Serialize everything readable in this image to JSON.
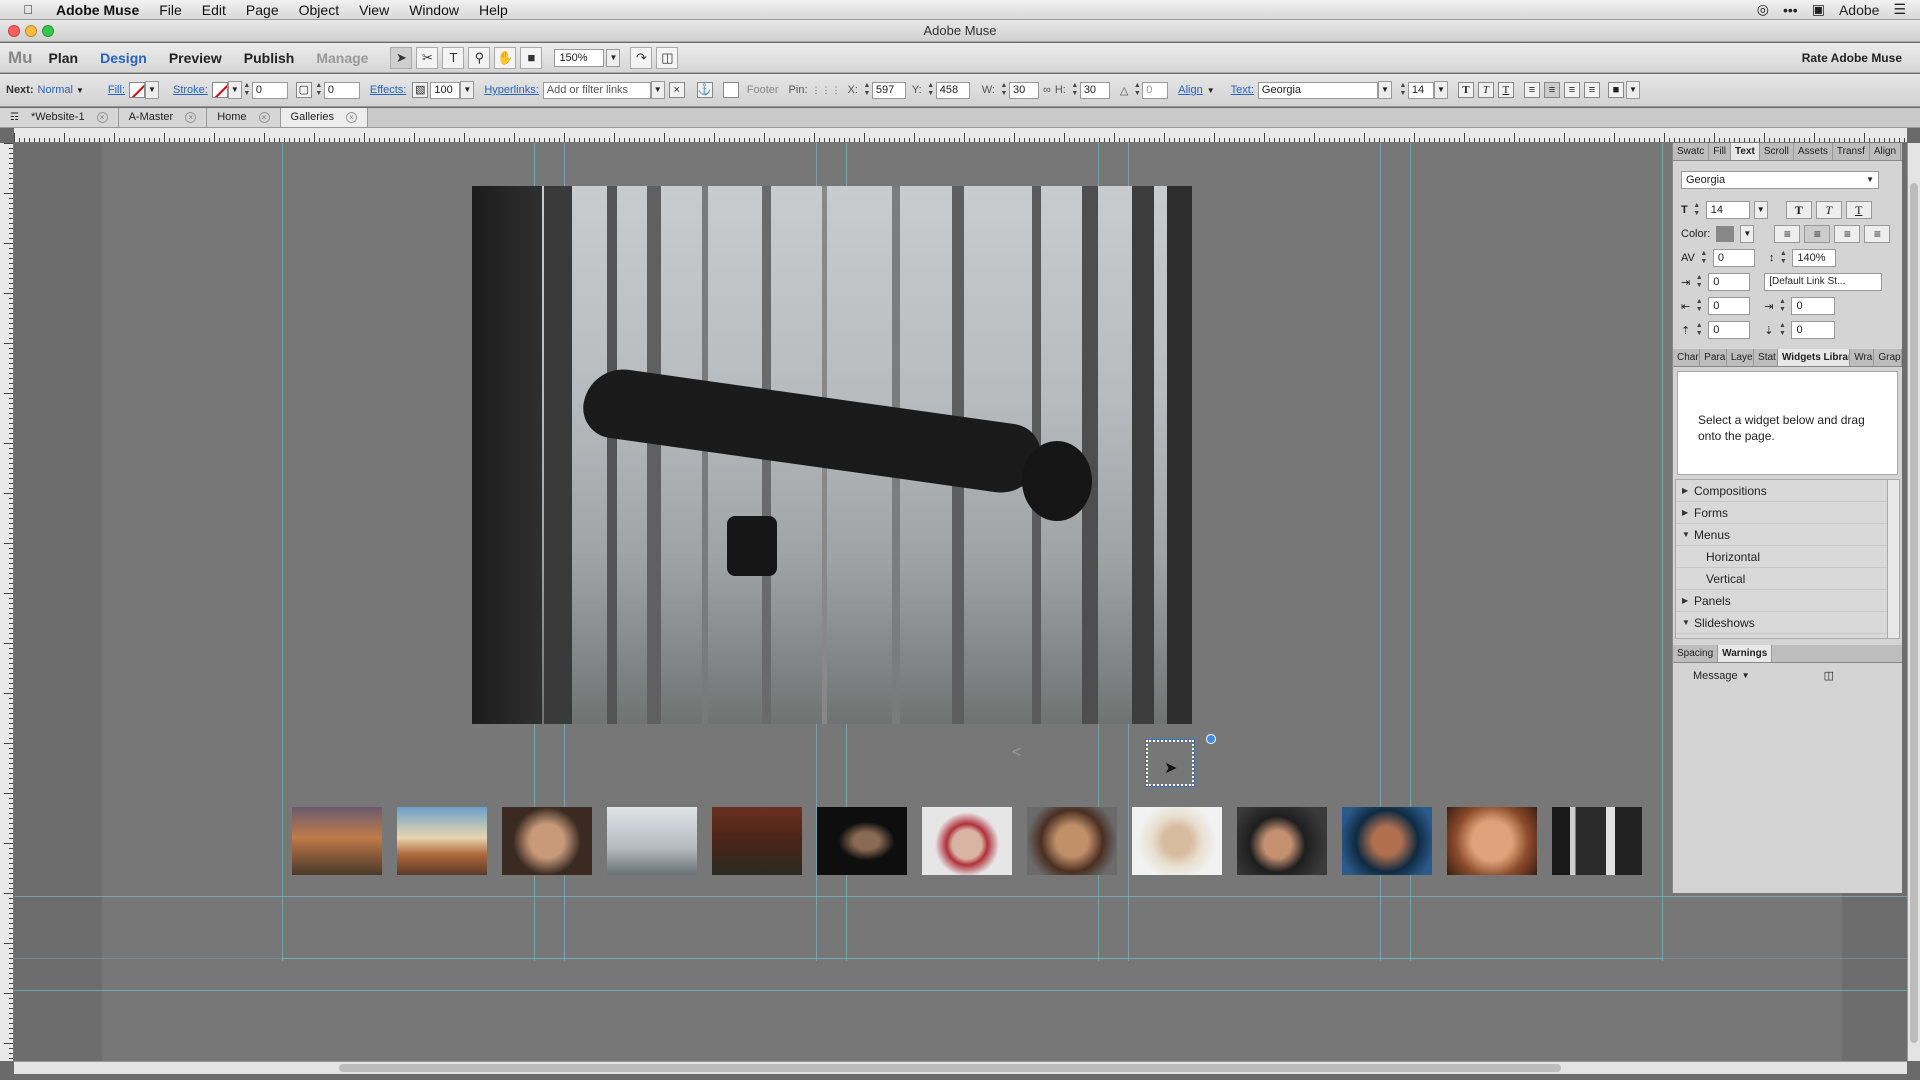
{
  "menubar": {
    "app_name": "Adobe Muse",
    "items": [
      "File",
      "Edit",
      "Page",
      "Object",
      "View",
      "Window",
      "Help"
    ],
    "right_user": "Adobe"
  },
  "window": {
    "title": "Adobe Muse"
  },
  "toolbar": {
    "logo": "Mu",
    "modes": [
      "Plan",
      "Design",
      "Preview",
      "Publish",
      "Manage"
    ],
    "active_mode": "Design",
    "zoom": "150%",
    "rate_label": "Rate Adobe Muse"
  },
  "control": {
    "next_label": "Next:",
    "next_value": "Normal",
    "fill_label": "Fill:",
    "stroke_label": "Stroke:",
    "stroke_width": "0",
    "corner_radius": "0",
    "effects_label": "Effects:",
    "opacity": "100",
    "hyperlinks_label": "Hyperlinks:",
    "hyperlinks_placeholder": "Add or filter links",
    "footer_label": "Footer",
    "pin_label": "Pin:",
    "x_label": "X:",
    "x_value": "597",
    "y_label": "Y:",
    "y_value": "458",
    "w_label": "W:",
    "w_value": "30",
    "h_label": "H:",
    "h_value": "30",
    "rotation": "0",
    "align_label": "Align",
    "text_label": "Text:",
    "font": "Georgia",
    "font_size": "14"
  },
  "tabs": [
    {
      "label": "*Website-1"
    },
    {
      "label": "A-Master"
    },
    {
      "label": "Home"
    },
    {
      "label": "Galleries"
    }
  ],
  "text_panel": {
    "tabs": [
      "Swatc",
      "Fill",
      "Text",
      "Scroll",
      "Assets",
      "Transf",
      "Align"
    ],
    "active_tab": "Text",
    "font": "Georgia",
    "size": "14",
    "color_label": "Color:",
    "tracking": "0",
    "leading": "140%",
    "indent": "0",
    "link_style": "[Default Link St...",
    "left_indent": "0",
    "right_indent": "0",
    "space_before": "0",
    "space_after": "0"
  },
  "widgets_panel": {
    "tabs": [
      "Char",
      "Para",
      "Laye",
      "Stat",
      "Widgets Library",
      "Wra",
      "Grap"
    ],
    "active_tab": "Widgets Library",
    "description": "Select a widget below and drag onto the page.",
    "items": [
      {
        "label": "Compositions",
        "expanded": false
      },
      {
        "label": "Forms",
        "expanded": false
      },
      {
        "label": "Menus",
        "expanded": true
      },
      {
        "label": "Horizontal",
        "sub": true
      },
      {
        "label": "Vertical",
        "sub": true
      },
      {
        "label": "Panels",
        "expanded": false
      },
      {
        "label": "Slideshows",
        "expanded": true
      }
    ]
  },
  "warnings_panel": {
    "tabs": [
      "Spacing",
      "Warnings"
    ],
    "active_tab": "Warnings",
    "message_label": "Message"
  },
  "canvas": {
    "prev_arrow": "<"
  }
}
